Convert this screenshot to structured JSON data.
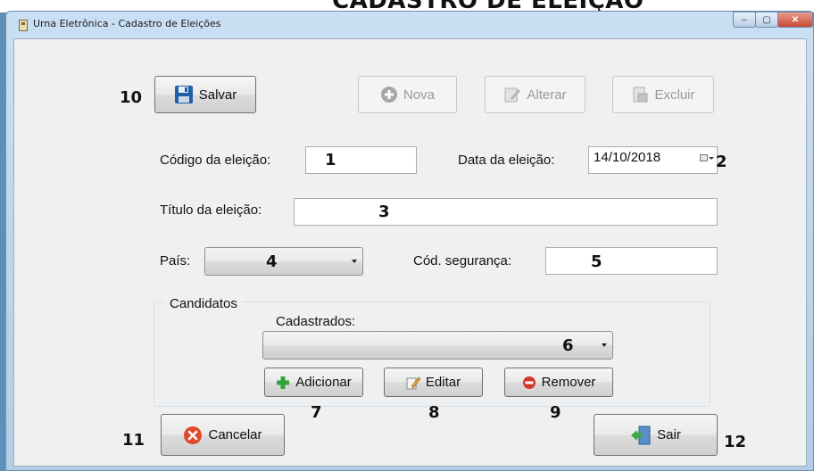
{
  "heading": "CADASTRO DE ELEIÇÃO",
  "window": {
    "title": "Urna Eletrônica - Cadastro de Eleições",
    "minimize": "–",
    "maximize": "▢",
    "close": "✕"
  },
  "toolbar": {
    "save_label": "Salvar",
    "new_label": "Nova",
    "edit_label": "Alterar",
    "delete_label": "Excluir"
  },
  "form": {
    "code_label": "Código da eleição:",
    "code_value": "",
    "date_label": "Data da eleição:",
    "date_value": "14/10/2018",
    "title_label": "Título da eleição:",
    "title_value": "",
    "country_label": "País:",
    "country_value": "",
    "security_label": "Cód. segurança:",
    "security_value": ""
  },
  "candidates": {
    "group_title": "Candidatos",
    "registered_label": "Cadastrados:",
    "registered_value": "",
    "add_label": "Adicionar",
    "edit_label": "Editar",
    "remove_label": "Remover"
  },
  "bottom": {
    "cancel_label": "Cancelar",
    "exit_label": "Sair"
  },
  "annotations": {
    "n1": "1",
    "n2": "2",
    "n3": "3",
    "n4": "4",
    "n5": "5",
    "n6": "6",
    "n7": "7",
    "n8": "8",
    "n9": "9",
    "n10": "10",
    "n11": "11",
    "n12": "12"
  },
  "icons": {
    "save": "floppy-disk-icon",
    "new": "plus-circle-icon",
    "edit": "pencil-document-icon",
    "delete": "delete-document-icon",
    "add": "green-plus-icon",
    "remove": "red-minus-icon",
    "cancel": "red-x-icon",
    "exit": "exit-door-icon",
    "app": "ballot-box-icon",
    "calendar": "calendar-icon"
  },
  "colors": {
    "window_chrome": "#b3cde7",
    "form_background": "#f0f0f0",
    "close_button": "#c84a33",
    "save_icon": "#1f5fa8",
    "add_icon": "#2ea43a",
    "remove_icon": "#d5362a"
  }
}
